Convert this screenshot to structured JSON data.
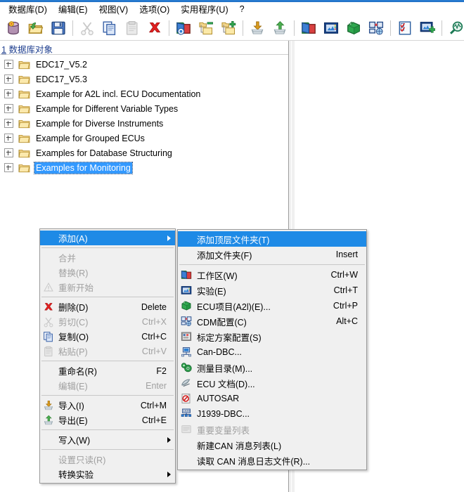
{
  "menubar": {
    "items": [
      {
        "label": "数据库(D)",
        "name": "menubar-database"
      },
      {
        "label": "编辑(E)",
        "name": "menubar-edit"
      },
      {
        "label": "视图(V)",
        "name": "menubar-view"
      },
      {
        "label": "选项(O)",
        "name": "menubar-options"
      },
      {
        "label": "实用程序(U)",
        "name": "menubar-utilities"
      },
      {
        "label": "?",
        "name": "menubar-help"
      }
    ]
  },
  "toolbar": {
    "buttons": [
      {
        "name": "new-database-icon",
        "title": "新建数据库"
      },
      {
        "name": "open-folder-icon",
        "title": "打开"
      },
      {
        "name": "save-icon",
        "title": "保存"
      },
      {
        "sep": true
      },
      {
        "name": "cut-icon",
        "title": "剪切",
        "disabled": true
      },
      {
        "name": "copy-icon",
        "title": "复制"
      },
      {
        "name": "paste-icon",
        "title": "粘贴",
        "disabled": true
      },
      {
        "name": "delete-icon",
        "title": "删除"
      },
      {
        "sep": true
      },
      {
        "name": "view-folder-icon",
        "title": "查看"
      },
      {
        "name": "remove-folder-icon",
        "title": "移除文件夹"
      },
      {
        "name": "add-folder-icon",
        "title": "添加文件夹"
      },
      {
        "sep": true
      },
      {
        "name": "import-icon",
        "title": "导入"
      },
      {
        "name": "export-icon",
        "title": "导出"
      },
      {
        "sep": true
      },
      {
        "name": "workspace-icon",
        "title": "工作区"
      },
      {
        "name": "experiment-icon",
        "title": "实验"
      },
      {
        "name": "ecu-project-icon",
        "title": "ECU项目"
      },
      {
        "name": "cdm-config-icon",
        "title": "CDM配置"
      },
      {
        "sep": true
      },
      {
        "name": "checklist-icon",
        "title": "检查表"
      },
      {
        "name": "add-experiment-icon",
        "title": "新增实验"
      },
      {
        "sep": true
      },
      {
        "name": "search-signal-icon",
        "title": "查找"
      }
    ]
  },
  "tree": {
    "header_number": "1",
    "header_label": "数据库对象",
    "items": [
      {
        "label": "EDC17_V5.2",
        "selected": false
      },
      {
        "label": "EDC17_V5.3",
        "selected": false
      },
      {
        "label": "Example for A2L incl. ECU Documentation",
        "selected": false
      },
      {
        "label": "Example for Different Variable Types",
        "selected": false
      },
      {
        "label": "Example for Diverse Instruments",
        "selected": false
      },
      {
        "label": "Example for Grouped ECUs",
        "selected": false
      },
      {
        "label": "Examples for Database Structuring",
        "selected": false
      },
      {
        "label": "Examples for Monitoring",
        "selected": true
      }
    ]
  },
  "context_menu": {
    "name": "database-context-menu",
    "items": [
      {
        "type": "item",
        "label": "添加(A)",
        "accel": "",
        "icon": "",
        "submenu": true,
        "highlighted": true,
        "disabled": false,
        "name": "menu-item-add"
      },
      {
        "type": "sep"
      },
      {
        "type": "item",
        "label": "合并",
        "accel": "",
        "icon": "",
        "disabled": true,
        "name": "menu-item-merge"
      },
      {
        "type": "item",
        "label": "替换(R)",
        "accel": "",
        "icon": "",
        "disabled": true,
        "name": "menu-item-replace"
      },
      {
        "type": "item",
        "label": "重新开始",
        "accel": "",
        "icon": "warning-icon",
        "disabled": true,
        "name": "menu-item-restart"
      },
      {
        "type": "sep"
      },
      {
        "type": "item",
        "label": "删除(D)",
        "accel": "Delete",
        "icon": "delete-icon",
        "disabled": false,
        "name": "menu-item-delete"
      },
      {
        "type": "item",
        "label": "剪切(C)",
        "accel": "Ctrl+X",
        "icon": "cut-icon",
        "disabled": true,
        "name": "menu-item-cut"
      },
      {
        "type": "item",
        "label": "复制(O)",
        "accel": "Ctrl+C",
        "icon": "copy-icon",
        "disabled": false,
        "name": "menu-item-copy"
      },
      {
        "type": "item",
        "label": "粘贴(P)",
        "accel": "Ctrl+V",
        "icon": "paste-icon",
        "disabled": true,
        "name": "menu-item-paste"
      },
      {
        "type": "sep"
      },
      {
        "type": "item",
        "label": "重命名(R)",
        "accel": "F2",
        "icon": "",
        "disabled": false,
        "name": "menu-item-rename"
      },
      {
        "type": "item",
        "label": "编辑(E)",
        "accel": "Enter",
        "icon": "",
        "disabled": true,
        "name": "menu-item-edit"
      },
      {
        "type": "sep"
      },
      {
        "type": "item",
        "label": "导入(I)",
        "accel": "Ctrl+M",
        "icon": "import-icon",
        "disabled": false,
        "name": "menu-item-import"
      },
      {
        "type": "item",
        "label": "导出(E)",
        "accel": "Ctrl+E",
        "icon": "export-icon",
        "disabled": false,
        "name": "menu-item-export"
      },
      {
        "type": "sep"
      },
      {
        "type": "item",
        "label": "写入(W)",
        "accel": "",
        "icon": "",
        "submenu": true,
        "disabled": false,
        "name": "menu-item-write"
      },
      {
        "type": "sep"
      },
      {
        "type": "item",
        "label": "设置只读(R)",
        "accel": "",
        "icon": "",
        "disabled": true,
        "name": "menu-item-set-readonly"
      },
      {
        "type": "item",
        "label": "转换实验",
        "accel": "",
        "icon": "",
        "submenu": true,
        "disabled": false,
        "name": "menu-item-convert-experiment"
      }
    ]
  },
  "add_submenu": {
    "name": "add-submenu",
    "items": [
      {
        "type": "item",
        "label": "添加顶层文件夹(T)",
        "accel": "",
        "icon": "",
        "highlighted": true,
        "disabled": false,
        "name": "submenu-item-add-top-folder"
      },
      {
        "type": "item",
        "label": "添加文件夹(F)",
        "accel": "Insert",
        "icon": "",
        "disabled": false,
        "name": "submenu-item-add-folder"
      },
      {
        "type": "sep"
      },
      {
        "type": "item",
        "label": "工作区(W)",
        "accel": "Ctrl+W",
        "icon": "workspace-icon",
        "disabled": false,
        "name": "submenu-item-workspace"
      },
      {
        "type": "item",
        "label": "实验(E)",
        "accel": "Ctrl+T",
        "icon": "experiment-icon",
        "disabled": false,
        "name": "submenu-item-experiment"
      },
      {
        "type": "item",
        "label": "ECU项目(A2l)(E)...",
        "accel": "Ctrl+P",
        "icon": "ecu-project-icon",
        "disabled": false,
        "name": "submenu-item-ecu-project"
      },
      {
        "type": "item",
        "label": "CDM配置(C)",
        "accel": "Alt+C",
        "icon": "cdm-config-icon",
        "disabled": false,
        "name": "submenu-item-cdm-config"
      },
      {
        "type": "item",
        "label": "标定方案配置(S)",
        "accel": "",
        "icon": "calibration-config-icon",
        "disabled": false,
        "name": "submenu-item-calibration-config"
      },
      {
        "type": "item",
        "label": "Can-DBC...",
        "accel": "",
        "icon": "can-dbc-icon",
        "disabled": false,
        "name": "submenu-item-can-dbc"
      },
      {
        "type": "item",
        "label": "测量目录(M)...",
        "accel": "",
        "icon": "measure-catalog-icon",
        "disabled": false,
        "name": "submenu-item-measure-catalog"
      },
      {
        "type": "item",
        "label": "ECU 文档(D)...",
        "accel": "",
        "icon": "ecu-doc-icon",
        "disabled": false,
        "name": "submenu-item-ecu-doc"
      },
      {
        "type": "item",
        "label": "AUTOSAR",
        "accel": "",
        "icon": "autosar-icon",
        "disabled": false,
        "name": "submenu-item-autosar"
      },
      {
        "type": "item",
        "label": "J1939-DBC...",
        "accel": "",
        "icon": "j1939-icon",
        "disabled": false,
        "name": "submenu-item-j1939-dbc"
      },
      {
        "type": "item",
        "label": "重要变量列表",
        "accel": "",
        "icon": "variable-list-icon",
        "disabled": true,
        "name": "submenu-item-important-variable-list"
      },
      {
        "type": "item",
        "label": "新建CAN 消息列表(L)",
        "accel": "",
        "icon": "",
        "disabled": false,
        "name": "submenu-item-new-can-message-list"
      },
      {
        "type": "item",
        "label": "读取 CAN 消息日志文件(R)...",
        "accel": "",
        "icon": "",
        "disabled": false,
        "name": "submenu-item-read-can-log"
      }
    ]
  },
  "colors": {
    "accent": "#1e8ae6",
    "selection": "#3399ff",
    "menu_bg": "#f0f0f0",
    "header_text": "#1f3f8f"
  }
}
